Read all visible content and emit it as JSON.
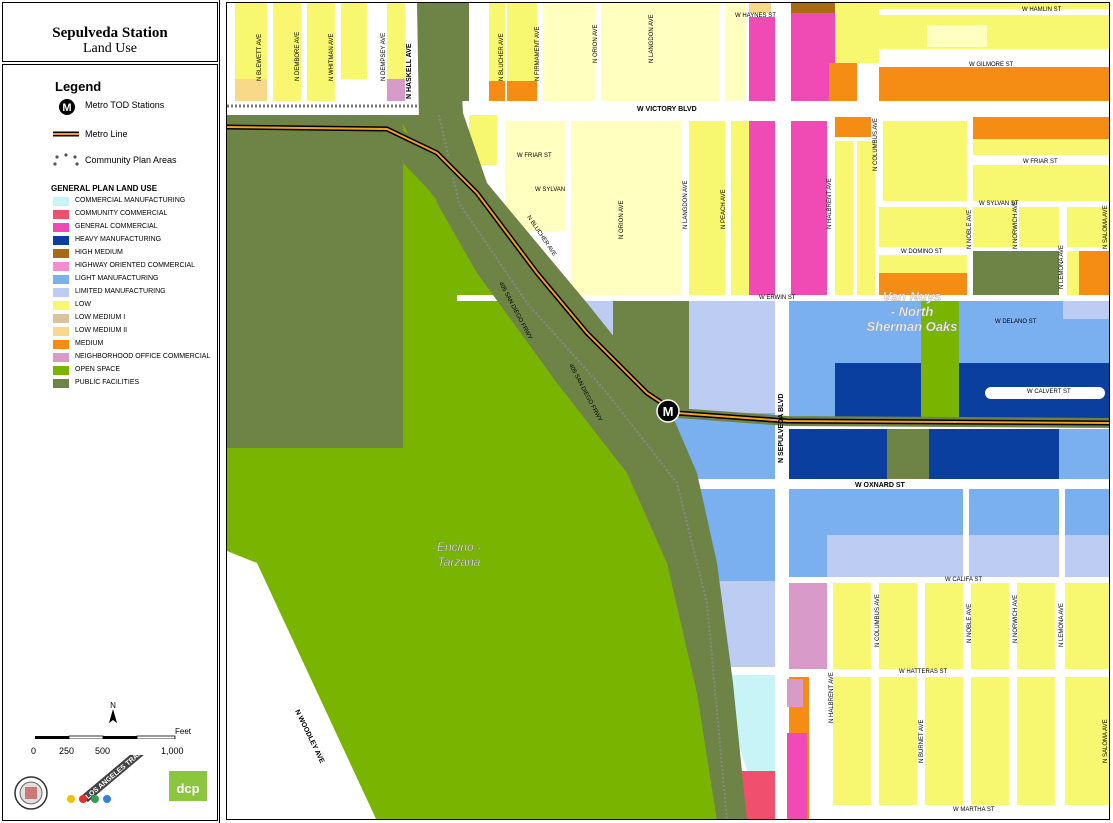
{
  "title": {
    "main": "Sepulveda Station",
    "sub": "Land Use"
  },
  "legend": {
    "heading": "Legend",
    "items": [
      {
        "label": "Metro TOD Stations",
        "icon": "metro-station-icon"
      },
      {
        "label": "Metro Line",
        "icon": "metro-line-icon"
      },
      {
        "label": "Community Plan Areas",
        "icon": "community-plan-boundary-icon"
      }
    ],
    "gpl_heading": "GENERAL PLAN LAND USE",
    "land_use": [
      {
        "label": "COMMERCIAL MANUFACTURING",
        "color": "#C8F4F8"
      },
      {
        "label": "COMMUNITY COMMERCIAL",
        "color": "#F0506E"
      },
      {
        "label": "GENERAL COMMERCIAL",
        "color": "#F04AB4"
      },
      {
        "label": "HEAVY MANUFACTURING",
        "color": "#0A3FA0"
      },
      {
        "label": "HIGH MEDIUM",
        "color": "#A86A14"
      },
      {
        "label": "HIGHWAY ORIENTED COMMERCIAL",
        "color": "#F58CD2"
      },
      {
        "label": "LIGHT MANUFACTURING",
        "color": "#7AB0F0"
      },
      {
        "label": "LIMITED MANUFACTURING",
        "color": "#BCCCF2"
      },
      {
        "label": "LOW",
        "color": "#F8F870"
      },
      {
        "label": "LOW MEDIUM I",
        "color": "#D8C49A"
      },
      {
        "label": "LOW MEDIUM II",
        "color": "#F8D98A"
      },
      {
        "label": "MEDIUM",
        "color": "#F58C14"
      },
      {
        "label": "NEIGHBORHOOD OFFICE COMMERCIAL",
        "color": "#D89AC8"
      },
      {
        "label": "OPEN SPACE",
        "color": "#78B400"
      },
      {
        "label": "PUBLIC FACILITIES",
        "color": "#6E8446"
      }
    ]
  },
  "scale": {
    "north": "N",
    "unit": "Feet",
    "ticks": [
      "0",
      "250",
      "500",
      "1,000"
    ]
  },
  "logos": {
    "program": "LOS ANGELES TRANSIT NEIGHBORHOOD PLANS",
    "dcp": "dcp"
  },
  "map": {
    "station_marker": "M",
    "area_labels": [
      "Van Nuys",
      "- North",
      "Sherman Oaks",
      "Encino -",
      "Tarzana"
    ],
    "streets_ew": [
      "W HAYNES ST",
      "W HAMLIN ST",
      "W GILMORE ST",
      "W VICTORY BLVD",
      "W FRIAR ST",
      "W FRIAR ST",
      "W SYLVAN",
      "W SYLVAN ST",
      "W DOMINO ST",
      "W ERWIN ST",
      "W DELANO ST",
      "W CALVERT ST",
      "W OXNARD ST",
      "W CALIFA ST",
      "W HATTERAS ST",
      "W MARTHA ST"
    ],
    "streets_ns": [
      "N BLEWETT AVE",
      "N DEMBORE AVE",
      "N WHITMAN AVE",
      "N DEMPSEY AVE",
      "N HASKELL AVE",
      "N BLUCHER AVE",
      "N FIRMAMENT AVE",
      "N ORION AVE",
      "N LANGDON AVE",
      "N BLUCHER AVE",
      "N ORION AVE",
      "N LANGDON AVE",
      "N PEACH AVE",
      "N HALBRENT AVE",
      "N COLUMBUS AVE",
      "N NOBLE AVE",
      "N NORWICH AVE",
      "N LEMONA AVE",
      "N SALOMA AVE",
      "N SEPULVEDA BLVD",
      "N HALBRENT AVE",
      "N COLUMBUS AVE",
      "N NOBLE AVE",
      "N NORWICH AVE",
      "N LEMONA AVE",
      "N BURNET AVE",
      "N SALOMA AVE",
      "N WOODLEY AVE"
    ],
    "freeway_labels": [
      "405 SAN DIEGO FRWY",
      "405 SAN DIEGO FRWY"
    ]
  }
}
